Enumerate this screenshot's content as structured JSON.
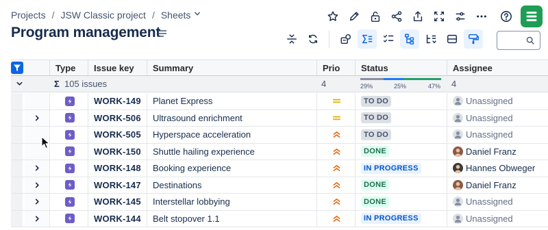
{
  "breadcrumb": {
    "items": [
      "Projects",
      "JSW Classic project",
      "Sheets"
    ],
    "separator": "/"
  },
  "page": {
    "title": "Program management"
  },
  "colors": {
    "accent": "#0c66e4",
    "brand": "#1f9d55",
    "issue_type": "#6e5dc6",
    "priority_medium": "#e2b203",
    "priority_high": "#e56910",
    "progress_todo": "#8590a2",
    "progress_inprogress": "#1d7afc",
    "progress_done": "#22a06b"
  },
  "grid": {
    "columns": [
      "Type",
      "Issue key",
      "Summary",
      "Prio",
      "Status",
      "Assignee"
    ],
    "summary": {
      "sigma": "Σ",
      "label": "105 issues",
      "prio_count": "4",
      "assignee_count": "4",
      "status_breakdown": [
        {
          "label": "29%",
          "fraction": 0.29
        },
        {
          "label": "25%",
          "fraction": 0.25
        },
        {
          "label": "47%",
          "fraction": 0.47
        }
      ]
    },
    "rows": [
      {
        "expandable": false,
        "key": "WORK-149",
        "summary": "Planet Express",
        "priority": "medium",
        "status": "TO DO",
        "status_style": "todo",
        "assignee": "Unassigned",
        "avatar": "unassigned"
      },
      {
        "expandable": true,
        "key": "WORK-506",
        "summary": "Ultrasound enrichment",
        "priority": "medium",
        "status": "TO DO",
        "status_style": "todo",
        "assignee": "Unassigned",
        "avatar": "unassigned"
      },
      {
        "expandable": false,
        "key": "WORK-505",
        "summary": "Hyperspace acceleration",
        "priority": "high",
        "status": "TO DO",
        "status_style": "todo",
        "assignee": "Unassigned",
        "avatar": "unassigned"
      },
      {
        "expandable": false,
        "key": "WORK-150",
        "summary": "Shuttle hailing experience",
        "priority": "high",
        "status": "DONE",
        "status_style": "done",
        "assignee": "Daniel Franz",
        "avatar": "daniel"
      },
      {
        "expandable": true,
        "key": "WORK-148",
        "summary": "Booking experience",
        "priority": "high",
        "status": "IN PROGRESS",
        "status_style": "prog",
        "assignee": "Hannes Obweger",
        "avatar": "hannes"
      },
      {
        "expandable": true,
        "key": "WORK-147",
        "summary": "Destinations",
        "priority": "high",
        "status": "DONE",
        "status_style": "done",
        "assignee": "Daniel Franz",
        "avatar": "daniel"
      },
      {
        "expandable": true,
        "key": "WORK-145",
        "summary": "Interstellar lobbying",
        "priority": "high",
        "status": "DONE",
        "status_style": "done",
        "assignee": "Unassigned",
        "avatar": "unassigned"
      },
      {
        "expandable": true,
        "key": "WORK-144",
        "summary": "Belt stopover 1.1",
        "priority": "high",
        "status": "IN PROGRESS",
        "status_style": "prog",
        "assignee": "Unassigned",
        "avatar": "unassigned"
      }
    ]
  },
  "icons": {
    "top_actions": [
      "star-icon",
      "edit-icon",
      "unlock-icon",
      "share-icon",
      "export-icon",
      "fullscreen-icon",
      "settings-sliders-icon",
      "more-icon",
      "help-icon"
    ],
    "toolbar": [
      "collapse-rows-icon",
      "refresh-icon",
      "structure-icon",
      "sum-icon",
      "checklist-icon",
      "hierarchy-icon",
      "tree-sort-icon",
      "row-height-icon",
      "format-paint-icon"
    ]
  }
}
